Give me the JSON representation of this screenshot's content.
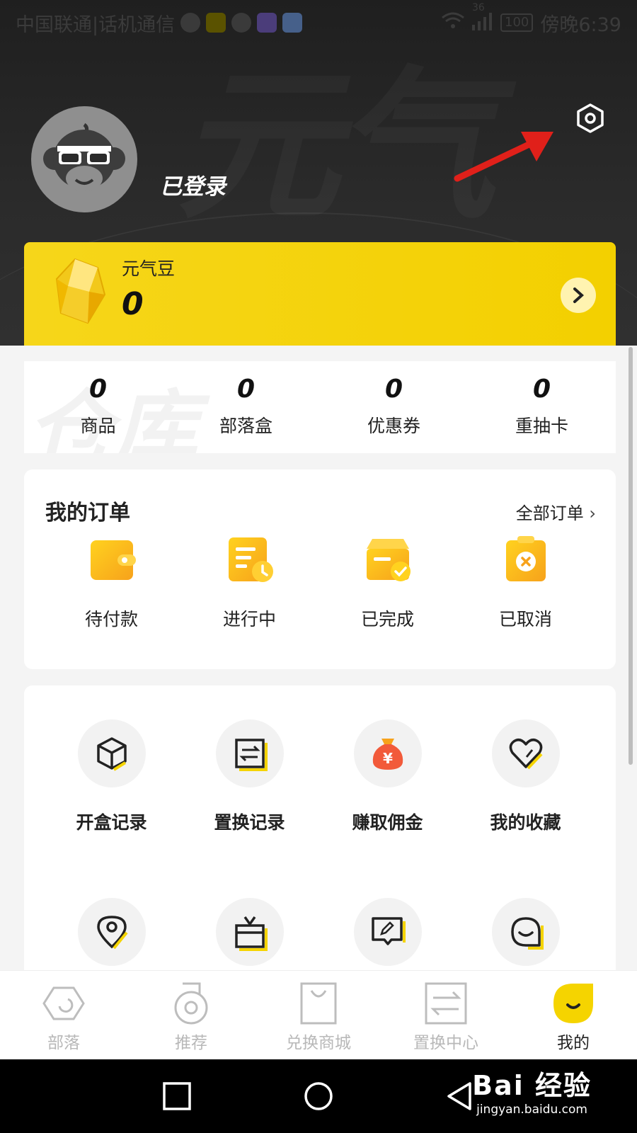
{
  "status_bar": {
    "carrier": "中国联通|话机通信",
    "network": "36",
    "battery": "100",
    "time": "傍晚6:39"
  },
  "profile": {
    "username": "已登录",
    "settings_icon": "settings-hex-icon"
  },
  "beans": {
    "title": "元气豆",
    "count": "0"
  },
  "stats": [
    {
      "value": "0",
      "label": "商品"
    },
    {
      "value": "0",
      "label": "部落盒"
    },
    {
      "value": "0",
      "label": "优惠券"
    },
    {
      "value": "0",
      "label": "重抽卡"
    }
  ],
  "stats_watermark": "仓库",
  "orders": {
    "title": "我的订单",
    "all_label": "全部订单",
    "items": [
      {
        "label": "待付款",
        "icon": "wallet-icon"
      },
      {
        "label": "进行中",
        "icon": "clock-doc-icon"
      },
      {
        "label": "已完成",
        "icon": "box-check-icon"
      },
      {
        "label": "已取消",
        "icon": "clipboard-x-icon"
      }
    ]
  },
  "tools": [
    {
      "label": "开盒记录",
      "icon": "cube-icon"
    },
    {
      "label": "置换记录",
      "icon": "swap-icon"
    },
    {
      "label": "赚取佣金",
      "icon": "money-bag-icon"
    },
    {
      "label": "我的收藏",
      "icon": "heart-icon"
    },
    {
      "label": "",
      "icon": "location-icon"
    },
    {
      "label": "",
      "icon": "gift-box-icon"
    },
    {
      "label": "",
      "icon": "edit-message-icon"
    },
    {
      "label": "",
      "icon": "chat-bubble-icon"
    }
  ],
  "tabs": [
    {
      "label": "部落",
      "active": false
    },
    {
      "label": "推荐",
      "active": false
    },
    {
      "label": "兑换商城",
      "active": false
    },
    {
      "label": "置换中心",
      "active": false
    },
    {
      "label": "我的",
      "active": true
    }
  ],
  "watermark": {
    "brand": "Bai 经验",
    "url": "jingyan.baidu.com"
  },
  "colors": {
    "accent": "#F5D400",
    "orange": "#F9A825",
    "header_bg": "#262626",
    "arrow": "#E0201A"
  }
}
